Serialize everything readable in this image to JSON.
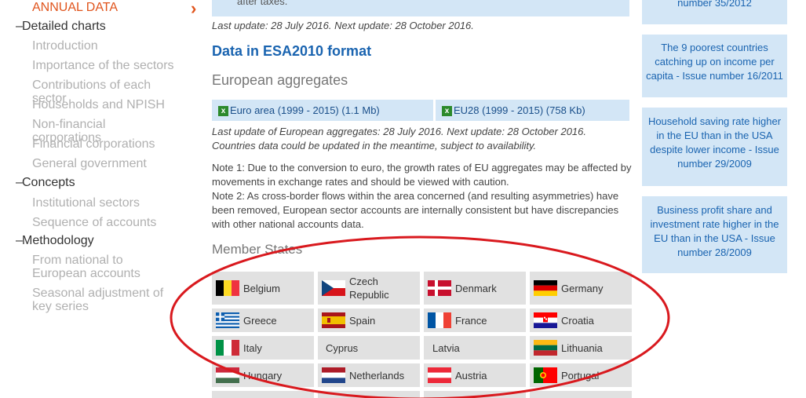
{
  "nav": {
    "active": "ANNUAL DATA",
    "detailed_charts": "Detailed charts",
    "detailed_items": [
      "Introduction",
      "Importance of the sectors",
      "Contributions of each sector",
      "Households and NPISH",
      "Non-financial corporations",
      "Financial corporations",
      "General government"
    ],
    "concepts": "Concepts",
    "concepts_items": [
      "Institutional sectors",
      "Sequence of accounts"
    ],
    "methodology": "Methodology",
    "methodology_items": [
      "From national to European accounts",
      "Seasonal adjustment of key series"
    ],
    "dash": "–"
  },
  "main": {
    "top_text": "after taxes.",
    "last_update": "Last update: 28 July 2016. Next update: 28 October 2016.",
    "esa_title": "Data in ESA2010 format",
    "european_aggregates": "European aggregates",
    "downloads": [
      "Euro area (1999 - 2015) (1.1 Mb)",
      "EU28 (1999 - 2015) (758 Kb)"
    ],
    "aggregates_update": "Last update of European aggregates: 28 July 2016. Next update: 28 October 2016. Countries data could be updated in the meantime, subject to availability.",
    "note1": "Note 1: Due to the conversion to euro, the growth rates of EU aggregates may be affected by movements in exchange rates and should be viewed with caution.",
    "note2": "Note 2: As cross-border flows within the area concerned (and resulting asymmetries) have been removed, European sector accounts are internally consistent but have discrepancies with other national accounts data.",
    "member_states": "Member States",
    "countries": [
      "Belgium",
      "Czech Republic",
      "Denmark",
      "Germany",
      "Greece",
      "Spain",
      "France",
      "Croatia",
      "Italy",
      "Cyprus",
      "Latvia",
      "Lithuania",
      "Hungary",
      "Netherlands",
      "Austria",
      "Portugal"
    ]
  },
  "right": {
    "boxes": [
      "number 35/2012",
      "The 9 poorest countries catching up on income per capita - Issue number 16/2011",
      "Household saving rate higher in the EU than in the USA despite lower income - Issue number 29/2009",
      "Business profit share and investment rate higher in the EU than in the USA - Issue number 28/2009"
    ]
  },
  "colors": {
    "accent": "#e0541c",
    "link": "#1a64b0",
    "box": "#d3e6f6",
    "annotation": "#d9191e"
  },
  "icons": {
    "xls": "excel-file-icon",
    "chevron": "chevron-right-icon"
  }
}
